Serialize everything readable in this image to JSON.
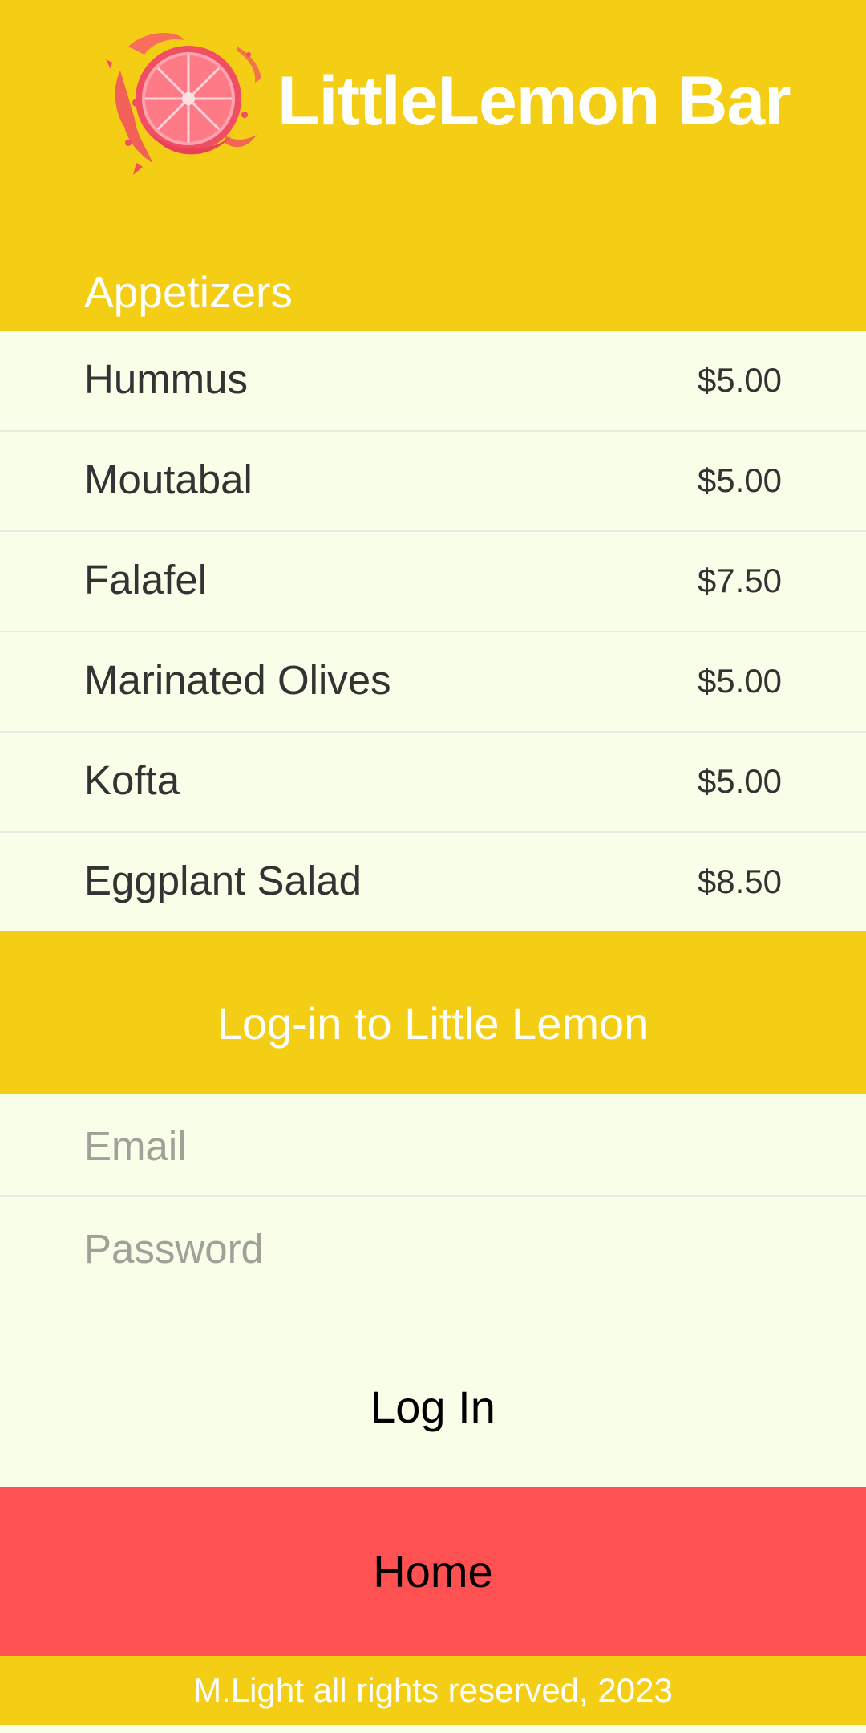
{
  "colors": {
    "primary_yellow": "#F4CE14",
    "list_background": "#F8FEE7",
    "home_button": "#FF5151"
  },
  "header": {
    "logo_icon": "grapefruit-splash-icon",
    "title": "LittleLemon Bar"
  },
  "menu": {
    "section_title": "Appetizers",
    "items": [
      {
        "name": "Hummus",
        "price": "$5.00"
      },
      {
        "name": "Moutabal",
        "price": "$5.00"
      },
      {
        "name": "Falafel",
        "price": "$7.50"
      },
      {
        "name": "Marinated Olives",
        "price": "$5.00"
      },
      {
        "name": "Kofta",
        "price": "$5.00"
      },
      {
        "name": "Eggplant Salad",
        "price": "$8.50"
      }
    ]
  },
  "login": {
    "title": "Log-in to Little Lemon",
    "email_placeholder": "Email",
    "email_value": "",
    "password_placeholder": "Password",
    "password_value": "",
    "button_label": "Log In"
  },
  "home_button_label": "Home",
  "footer_text": "M.Light all rights reserved, 2023"
}
